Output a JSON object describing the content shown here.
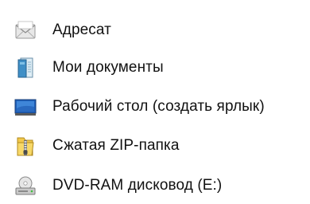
{
  "send_to_menu": {
    "items": [
      {
        "label": "Адресат",
        "icon": "mail-recipient-icon"
      },
      {
        "label": "Мои документы",
        "icon": "my-documents-icon"
      },
      {
        "label": "Рабочий стол (создать ярлык)",
        "icon": "desktop-icon"
      },
      {
        "label": "Сжатая ZIP-папка",
        "icon": "zip-folder-icon"
      },
      {
        "label": "DVD-RAM дисковод (E:)",
        "icon": "dvd-drive-icon"
      }
    ]
  }
}
